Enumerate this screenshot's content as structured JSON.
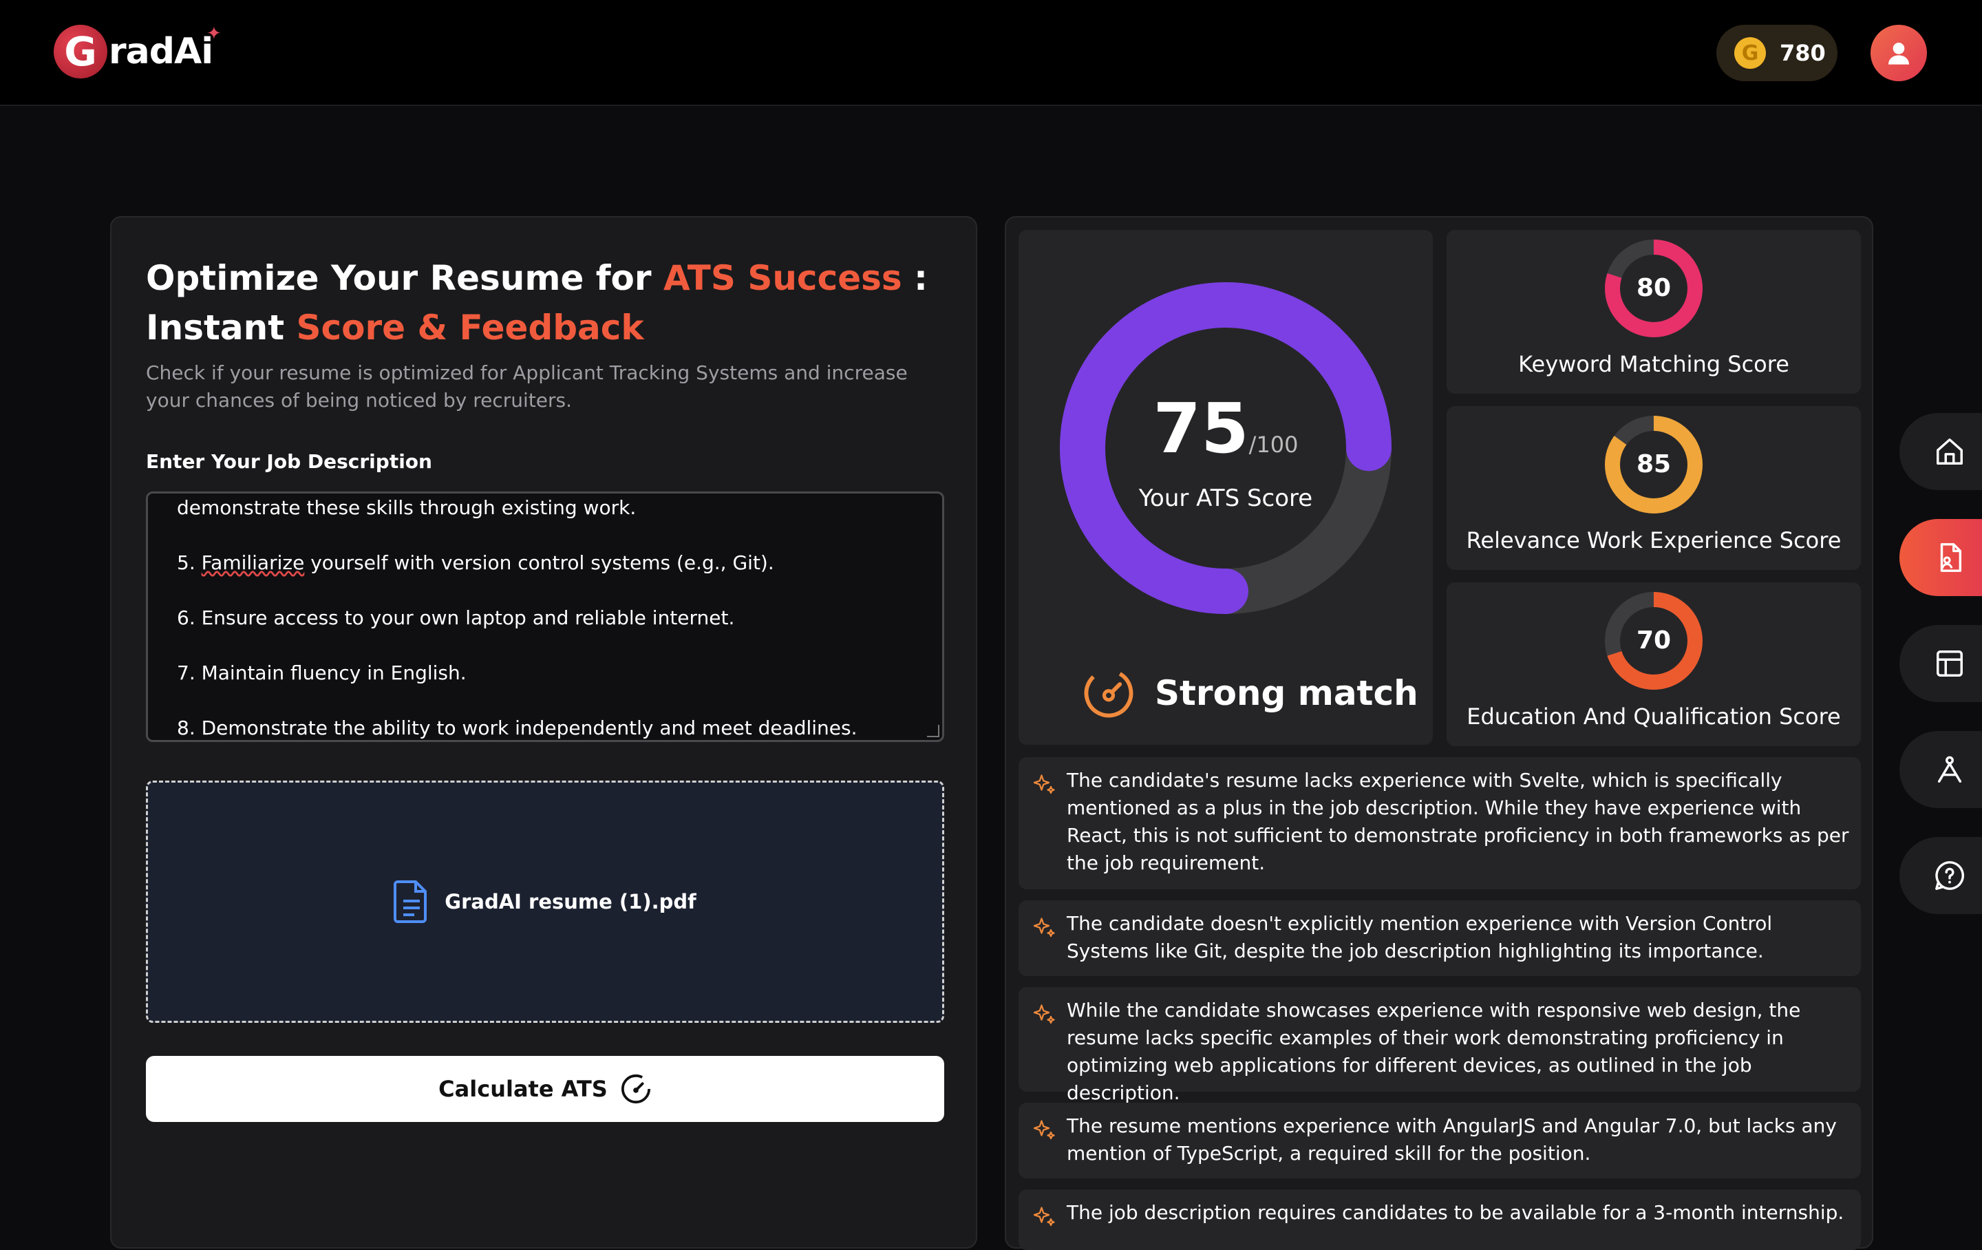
{
  "header": {
    "logo_letter": "G",
    "logo_text": "radAi",
    "coin_letter": "G",
    "coins": "780"
  },
  "hero": {
    "title_part1": "Optimize Your Resume for ",
    "title_accent1": "ATS Success",
    "title_part2": " :",
    "title_part3": "Instant ",
    "title_accent2": "Score & Feedback",
    "subtitle": "Check if your resume is optimized for Applicant Tracking Systems and increase your chances of being noticed by recruiters."
  },
  "job_description": {
    "label": "Enter Your Job Description",
    "lines": [
      "demonstrate these skills through existing work.",
      "5. ",
      "Familiarize",
      " yourself with version control systems (e.g., Git).",
      "6. Ensure access to your own laptop and reliable internet.",
      "7. Maintain fluency in English.",
      "8. Demonstrate the ability to work independently and meet deadlines."
    ]
  },
  "upload": {
    "file_name": "GradAI resume (1).pdf"
  },
  "calculate_button": {
    "label": "Calculate ATS"
  },
  "ats": {
    "score": "75",
    "max": "/100",
    "label": "Your ATS Score",
    "match_label": "Strong match",
    "score_value": 75
  },
  "sub_scores": [
    {
      "value": "80",
      "label": "Keyword Matching Score",
      "fraction": 0.8,
      "color": "#e8306a"
    },
    {
      "value": "85",
      "label": "Relevance Work Experience Score",
      "fraction": 0.85,
      "color": "#f0a63a"
    },
    {
      "value": "70",
      "label": "Education And Qualification Score",
      "fraction": 0.7,
      "color": "#ec5b2e"
    }
  ],
  "feedback": [
    "The candidate's resume lacks experience with Svelte, which is specifically mentioned as a plus in the job description. While they have experience with React, this is not sufficient to demonstrate proficiency in both frameworks as per the job requirement.",
    "The candidate doesn't explicitly mention experience with Version Control Systems like Git, despite the job description highlighting its importance.",
    "While the candidate showcases experience with responsive web design, the resume lacks specific examples of their work demonstrating proficiency in optimizing web applications for different devices, as outlined in the job description.",
    "The resume mentions experience with AngularJS and Angular 7.0, but lacks any mention of TypeScript, a required skill for the position.",
    "The job description requires candidates to be available for a 3-month internship."
  ],
  "colors": {
    "accent": "#f15b3d",
    "ats_ring": "#7b3fe4",
    "ring_track": "#3d3d40",
    "sparkle": "#f08a3c"
  },
  "side_nav": [
    "home-icon",
    "resume-ats-icon",
    "layout-icon",
    "interview-icon",
    "help-icon"
  ]
}
